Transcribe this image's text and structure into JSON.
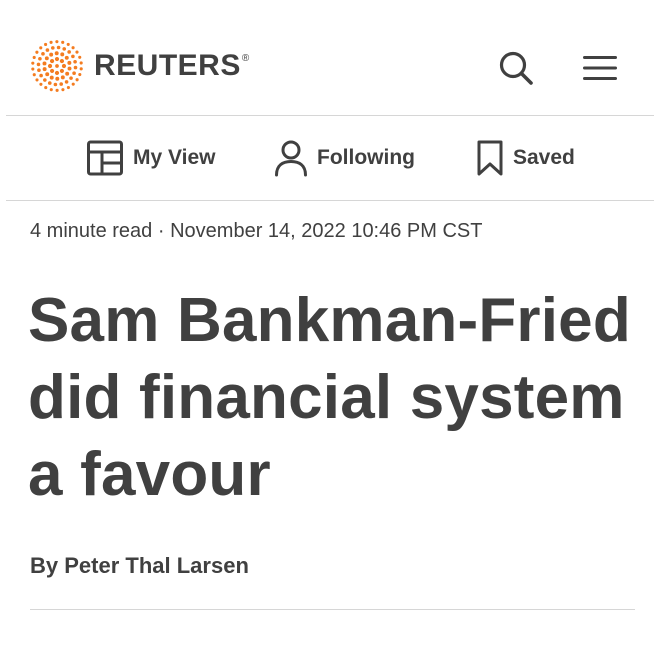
{
  "brand": {
    "name": "REUTERS",
    "reg_mark": "®",
    "accent_color": "#f47c20",
    "text_color": "#404040"
  },
  "header": {
    "search_icon": "search-icon",
    "menu_icon": "hamburger-menu-icon"
  },
  "nav": {
    "items": [
      {
        "label": "My View",
        "icon": "layout-grid-icon"
      },
      {
        "label": "Following",
        "icon": "user-icon"
      },
      {
        "label": "Saved",
        "icon": "bookmark-icon"
      }
    ]
  },
  "article": {
    "read_time": "4 minute read",
    "separator": "·",
    "timestamp": "November 14, 2022 10:46 PM CST",
    "headline": "Sam Bankman-Fried did financial system a favour",
    "byline_prefix": "By",
    "author": "Peter Thal Larsen"
  }
}
